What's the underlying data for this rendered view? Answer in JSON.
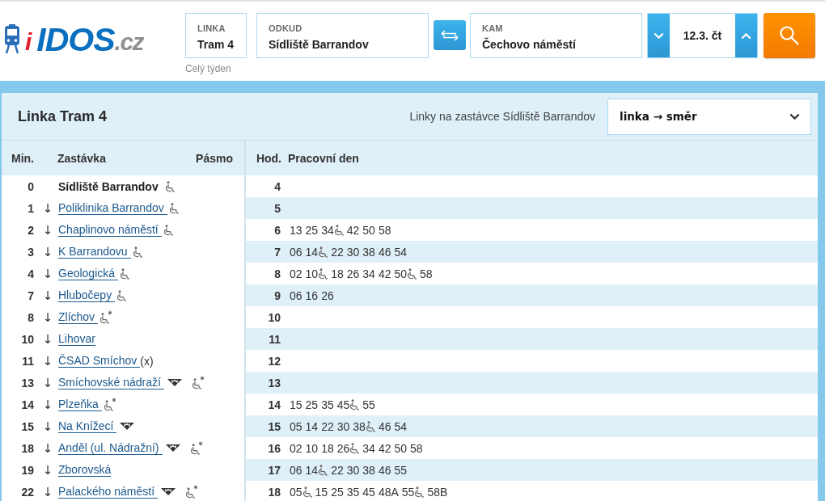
{
  "logo": {
    "badge": "i",
    "name": "IDOS",
    "domain": ".cz"
  },
  "search": {
    "line": {
      "label": "LINKA",
      "value": "Tram 4",
      "note": "Celý týden"
    },
    "from": {
      "label": "ODKUD",
      "value": "Sídliště Barrandov"
    },
    "to": {
      "label": "KAM",
      "value": "Čechovo náměstí"
    },
    "date": {
      "value": "12.3. čt"
    }
  },
  "panel": {
    "title": "Linka Tram 4",
    "stops_label": "Linky na zastávce Sídliště Barrandov",
    "view_select": {
      "value": "linka → směr"
    }
  },
  "stops": {
    "columns": [
      "Min.",
      "Zastávka",
      "Pásmo"
    ],
    "rows": [
      {
        "min": "0",
        "name": "Sídliště Barrandov",
        "current": true,
        "metro": false,
        "wheelchair": true,
        "limited": false
      },
      {
        "min": "1",
        "arrow": "↓",
        "name": "Poliklinika Barrandov",
        "current": false,
        "metro": false,
        "wheelchair": true,
        "limited": false
      },
      {
        "min": "2",
        "arrow": "↓",
        "name": "Chaplinovo náměstí",
        "current": false,
        "metro": false,
        "wheelchair": true,
        "limited": false
      },
      {
        "min": "3",
        "arrow": "↓",
        "name": "K Barrandovu",
        "current": false,
        "metro": false,
        "wheelchair": true,
        "limited": false
      },
      {
        "min": "4",
        "arrow": "↓",
        "name": "Geologická",
        "current": false,
        "metro": false,
        "wheelchair": true,
        "limited": false
      },
      {
        "min": "7",
        "arrow": "↓",
        "name": "Hlubočepy",
        "current": false,
        "metro": false,
        "wheelchair": true,
        "limited": false
      },
      {
        "min": "8",
        "arrow": "↓",
        "name": "Zlíchov",
        "current": false,
        "metro": false,
        "wheelchair": true,
        "limited": true
      },
      {
        "min": "10",
        "arrow": "↓",
        "name": "Lihovar",
        "current": false,
        "metro": false,
        "wheelchair": false,
        "limited": false
      },
      {
        "min": "11",
        "arrow": "↓",
        "name": "ČSAD Smíchov",
        "note": "(x)",
        "current": false,
        "metro": false,
        "wheelchair": false,
        "limited": false
      },
      {
        "min": "13",
        "arrow": "↓",
        "name": "Smíchovské nádraží",
        "current": false,
        "metro": true,
        "wheelchair": true,
        "limited": true
      },
      {
        "min": "14",
        "arrow": "↓",
        "name": "Plzeňka",
        "current": false,
        "metro": false,
        "wheelchair": true,
        "limited": true
      },
      {
        "min": "15",
        "arrow": "↓",
        "name": "Na Knížecí",
        "current": false,
        "metro": true,
        "wheelchair": false,
        "limited": false
      },
      {
        "min": "18",
        "arrow": "↓",
        "name": "Anděl (ul. Nádražní)",
        "current": false,
        "metro": true,
        "wheelchair": true,
        "limited": true
      },
      {
        "min": "19",
        "arrow": "↓",
        "name": "Zborovská",
        "current": false,
        "metro": false,
        "wheelchair": false,
        "limited": false
      },
      {
        "min": "22",
        "arrow": "↓",
        "name": "Palackého náměstí",
        "current": false,
        "metro": true,
        "wheelchair": true,
        "limited": true
      }
    ]
  },
  "timetable": {
    "columns": [
      "Hod.",
      "Pracovní den"
    ],
    "rows": [
      {
        "hour": "4"
      },
      {
        "hour": "5"
      },
      {
        "hour": "6",
        "departures": [
          {
            "time": "13",
            "accessible": false
          },
          {
            "time": "25",
            "accessible": false
          },
          {
            "time": "34",
            "accessible": true
          },
          {
            "time": "42",
            "accessible": false
          },
          {
            "time": "50",
            "accessible": false
          },
          {
            "time": "58",
            "accessible": false
          }
        ]
      },
      {
        "hour": "7",
        "departures": [
          {
            "time": "06",
            "accessible": false
          },
          {
            "time": "14",
            "accessible": true
          },
          {
            "time": "22",
            "accessible": false
          },
          {
            "time": "30",
            "accessible": false
          },
          {
            "time": "38",
            "accessible": false
          },
          {
            "time": "46",
            "accessible": false
          },
          {
            "time": "54",
            "accessible": false
          }
        ]
      },
      {
        "hour": "8",
        "departures": [
          {
            "time": "02",
            "accessible": false
          },
          {
            "time": "10",
            "accessible": true
          },
          {
            "time": "18",
            "accessible": false
          },
          {
            "time": "26",
            "accessible": false
          },
          {
            "time": "34",
            "accessible": false
          },
          {
            "time": "42",
            "accessible": false
          },
          {
            "time": "50",
            "accessible": true
          },
          {
            "time": "58",
            "accessible": false
          }
        ]
      },
      {
        "hour": "9",
        "departures": [
          {
            "time": "06",
            "accessible": false
          },
          {
            "time": "16",
            "accessible": false
          },
          {
            "time": "26",
            "accessible": false
          }
        ]
      },
      {
        "hour": "10"
      },
      {
        "hour": "11"
      },
      {
        "hour": "12"
      },
      {
        "hour": "13"
      },
      {
        "hour": "14",
        "departures": [
          {
            "time": "15",
            "accessible": false
          },
          {
            "time": "25",
            "accessible": false
          },
          {
            "time": "35",
            "accessible": false
          },
          {
            "time": "45",
            "accessible": true
          },
          {
            "time": "55",
            "accessible": false
          }
        ]
      },
      {
        "hour": "15",
        "departures": [
          {
            "time": "05",
            "accessible": false
          },
          {
            "time": "14",
            "accessible": false
          },
          {
            "time": "22",
            "accessible": false
          },
          {
            "time": "30",
            "accessible": false
          },
          {
            "time": "38",
            "accessible": true
          },
          {
            "time": "46",
            "accessible": false
          },
          {
            "time": "54",
            "accessible": false
          }
        ]
      },
      {
        "hour": "16",
        "departures": [
          {
            "time": "02",
            "accessible": false
          },
          {
            "time": "10",
            "accessible": false
          },
          {
            "time": "18",
            "accessible": false
          },
          {
            "time": "26",
            "accessible": true
          },
          {
            "time": "34",
            "accessible": false
          },
          {
            "time": "42",
            "accessible": false
          },
          {
            "time": "50",
            "accessible": false
          },
          {
            "time": "58",
            "accessible": false
          }
        ]
      },
      {
        "hour": "17",
        "departures": [
          {
            "time": "06",
            "accessible": false
          },
          {
            "time": "14",
            "accessible": true
          },
          {
            "time": "22",
            "accessible": false
          },
          {
            "time": "30",
            "accessible": false
          },
          {
            "time": "38",
            "accessible": false
          },
          {
            "time": "46",
            "accessible": false
          },
          {
            "time": "55",
            "accessible": false
          }
        ]
      },
      {
        "hour": "18",
        "departures": [
          {
            "time": "05",
            "accessible": true
          },
          {
            "time": "15",
            "accessible": false
          },
          {
            "time": "25",
            "accessible": false
          },
          {
            "time": "35",
            "accessible": false
          },
          {
            "time": "45",
            "accessible": false
          },
          {
            "time": "48A",
            "accessible": false
          },
          {
            "time": "55",
            "accessible": true
          },
          {
            "time": "58B",
            "accessible": false
          }
        ]
      }
    ]
  }
}
